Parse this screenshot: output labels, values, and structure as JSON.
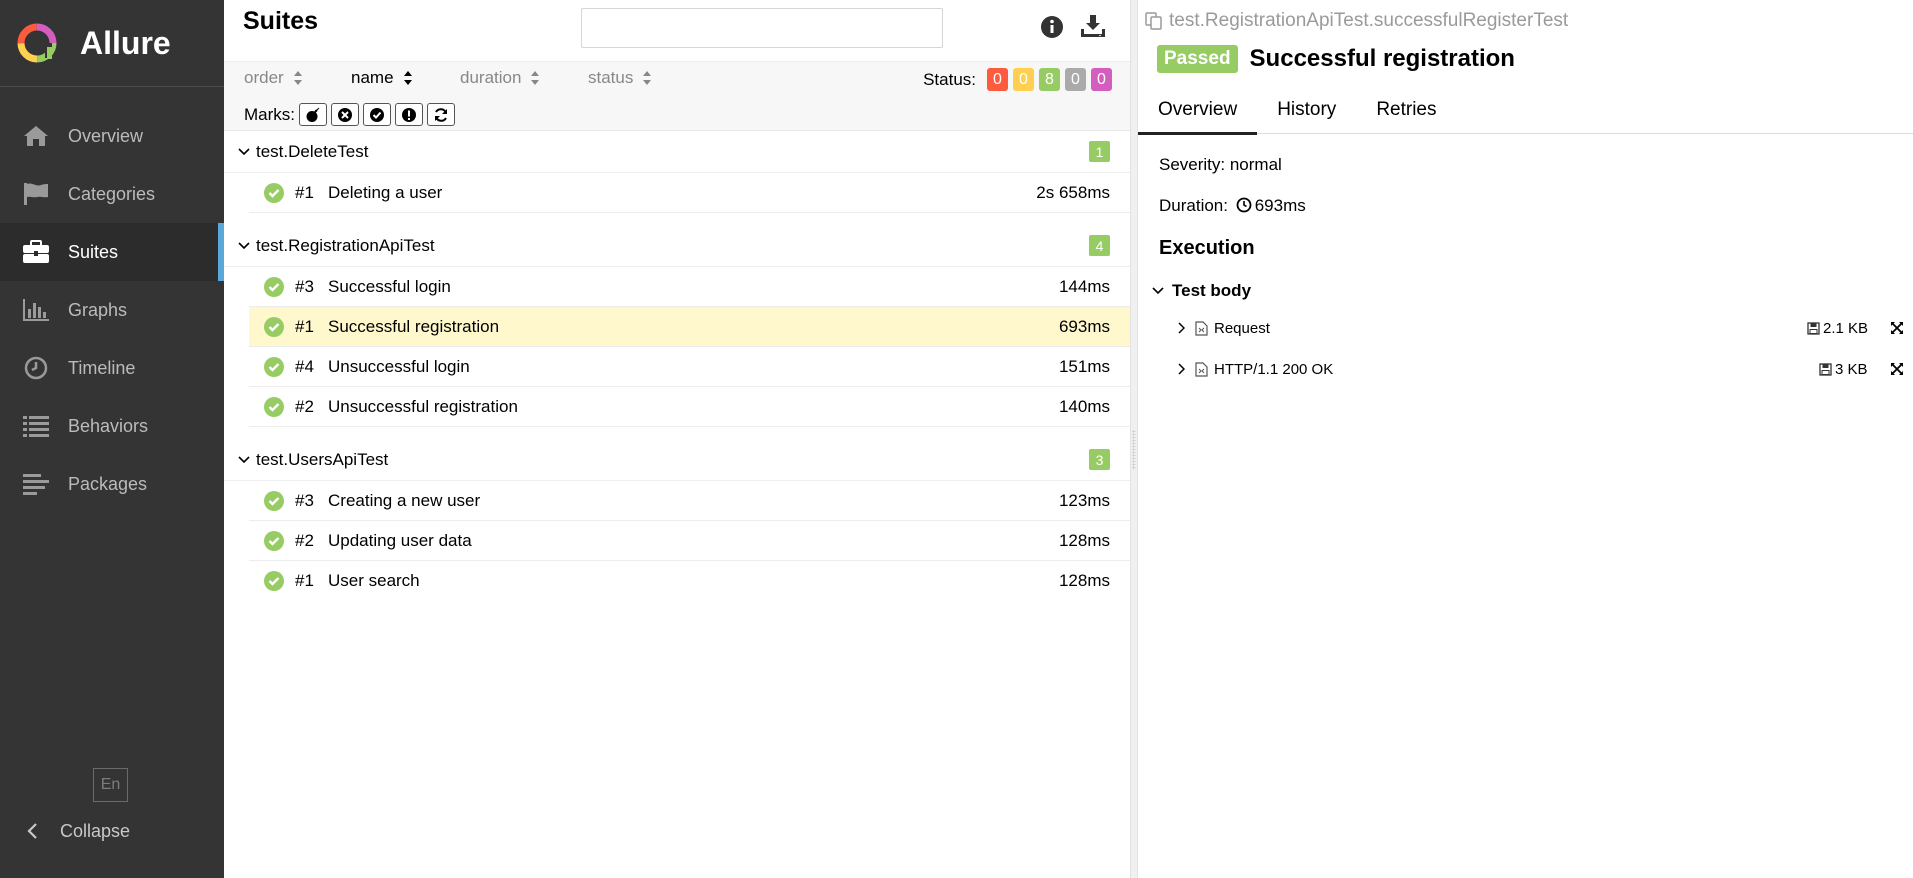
{
  "sidebar": {
    "brand": "Allure",
    "items": [
      {
        "label": "Overview",
        "icon": "home-icon"
      },
      {
        "label": "Categories",
        "icon": "flag-icon"
      },
      {
        "label": "Suites",
        "icon": "briefcase-icon",
        "active": true
      },
      {
        "label": "Graphs",
        "icon": "bar-chart-icon"
      },
      {
        "label": "Timeline",
        "icon": "clock-icon"
      },
      {
        "label": "Behaviors",
        "icon": "list-icon"
      },
      {
        "label": "Packages",
        "icon": "align-left-icon"
      }
    ],
    "language": "En",
    "collapse_label": "Collapse"
  },
  "suites_pane": {
    "title": "Suites",
    "search": {
      "value": "",
      "placeholder": ""
    },
    "sorters": [
      {
        "label": "order",
        "active": false
      },
      {
        "label": "name",
        "active": true
      },
      {
        "label": "duration",
        "active": false
      },
      {
        "label": "status",
        "active": false
      }
    ],
    "status_label": "Status:",
    "status_counts": [
      {
        "name": "failed",
        "value": "0",
        "color": "#fd5a3e"
      },
      {
        "name": "broken",
        "value": "0",
        "color": "#ffd050"
      },
      {
        "name": "passed",
        "value": "8",
        "color": "#97cc64"
      },
      {
        "name": "skipped",
        "value": "0",
        "color": "#aaaaaa"
      },
      {
        "name": "unknown",
        "value": "0",
        "color": "#d35ebe"
      }
    ],
    "marks_label": "Marks:",
    "groups": [
      {
        "name": "test.DeleteTest",
        "count": "1",
        "tests": [
          {
            "num": "#1",
            "name": "Deleting a user",
            "duration": "2s 658ms"
          }
        ]
      },
      {
        "name": "test.RegistrationApiTest",
        "count": "4",
        "tests": [
          {
            "num": "#3",
            "name": "Successful login",
            "duration": "144ms"
          },
          {
            "num": "#1",
            "name": "Successful registration",
            "duration": "693ms",
            "selected": true
          },
          {
            "num": "#4",
            "name": "Unsuccessful login",
            "duration": "151ms"
          },
          {
            "num": "#2",
            "name": "Unsuccessful registration",
            "duration": "140ms"
          }
        ]
      },
      {
        "name": "test.UsersApiTest",
        "count": "3",
        "tests": [
          {
            "num": "#3",
            "name": "Creating a new user",
            "duration": "123ms"
          },
          {
            "num": "#2",
            "name": "Updating user data",
            "duration": "128ms"
          },
          {
            "num": "#1",
            "name": "User search",
            "duration": "128ms"
          }
        ]
      }
    ]
  },
  "test_pane": {
    "full_name": "test.RegistrationApiTest.successfulRegisterTest",
    "status": "Passed",
    "status_color": "#97cc64",
    "title": "Successful registration",
    "tabs": [
      "Overview",
      "History",
      "Retries"
    ],
    "severity": "Severity: normal",
    "duration_label": "Duration:",
    "duration_value": "693ms",
    "execution_title": "Execution",
    "test_body_label": "Test body",
    "attachments": [
      {
        "name": "Request",
        "size": "2.1 KB"
      },
      {
        "name": "HTTP/1.1 200 OK",
        "size": "3 KB"
      }
    ]
  }
}
